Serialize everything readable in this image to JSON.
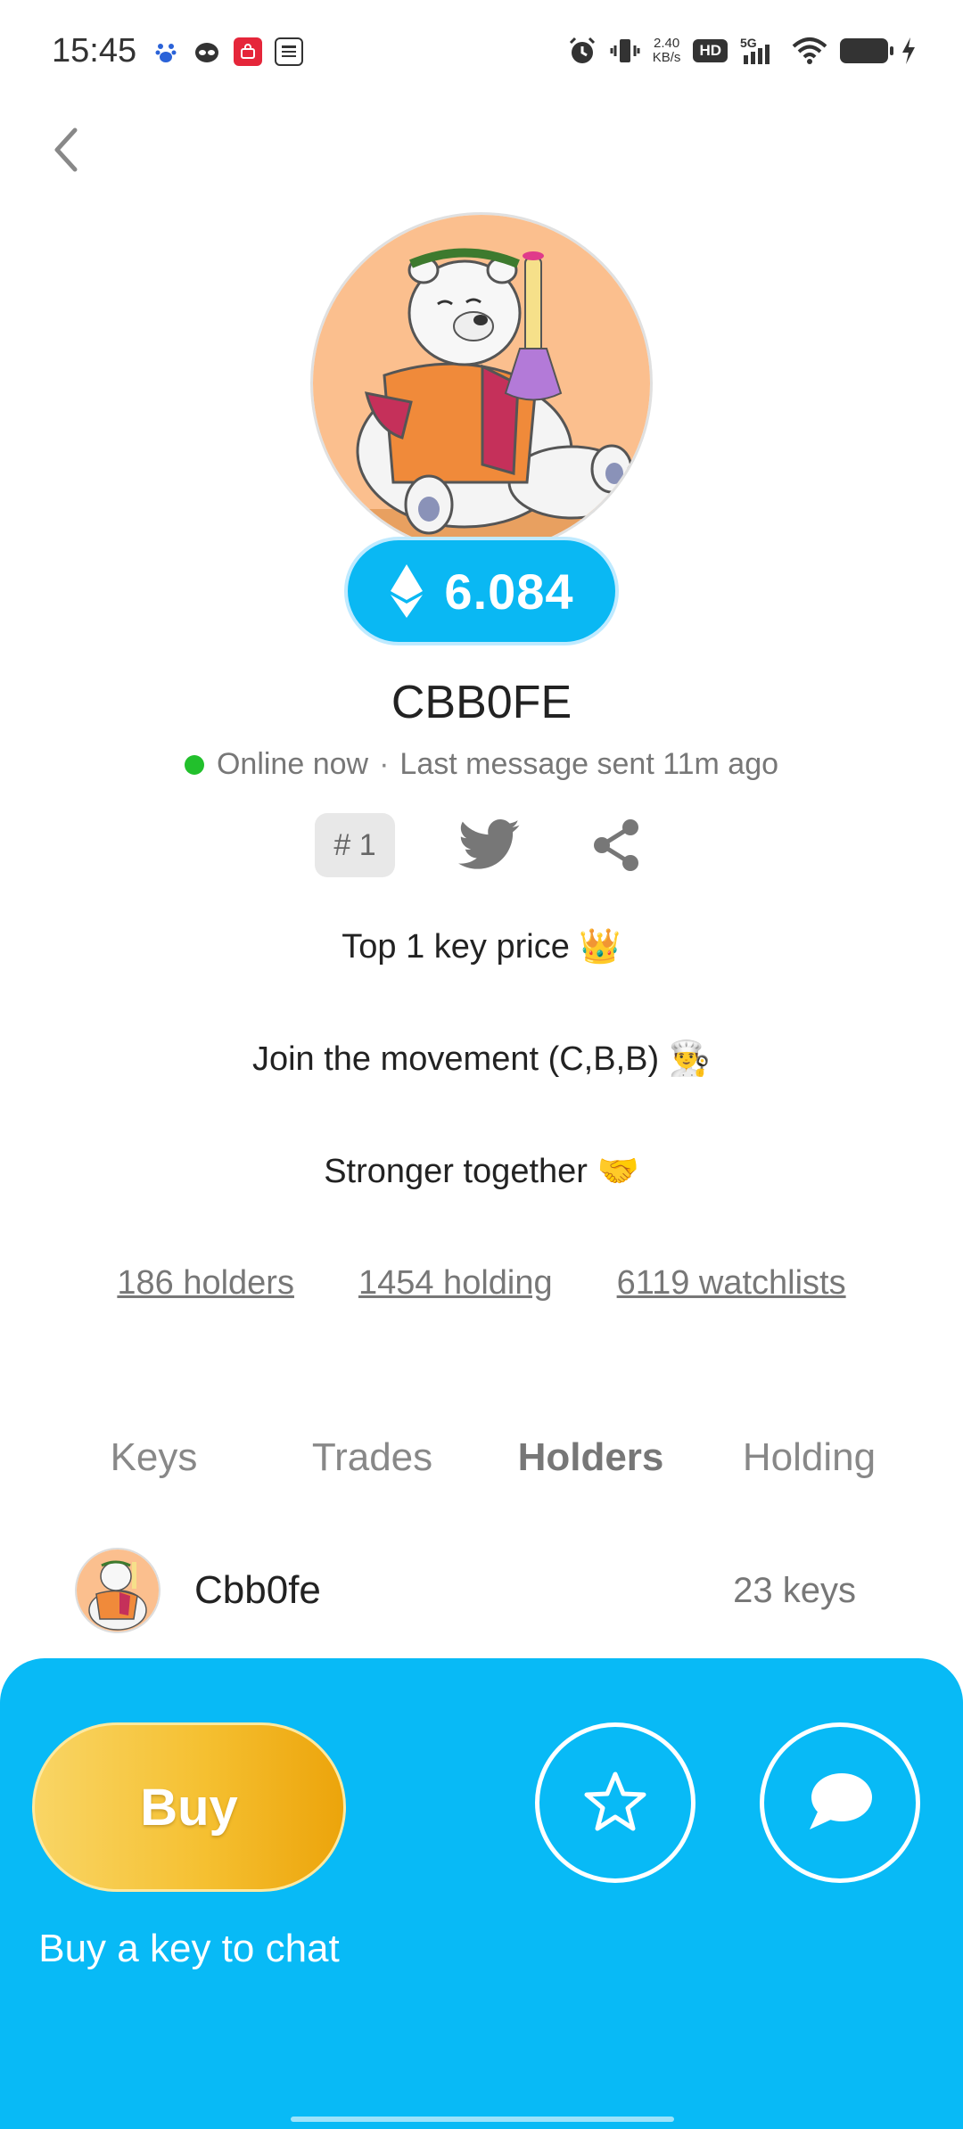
{
  "status_bar": {
    "time": "15:45",
    "net_speed_value": "2.40",
    "net_speed_unit": "KB/s",
    "hd": "HD",
    "network": "5G",
    "icons": [
      "baidu-icon",
      "cat-icon",
      "shopping-icon",
      "news-icon",
      "alarm-icon",
      "vibrate-icon",
      "wifi-icon",
      "battery-icon",
      "charging-icon"
    ]
  },
  "profile": {
    "price": "6.084",
    "currency_icon": "ethereum-icon",
    "username": "CBB0FE",
    "online_status": "Online now",
    "last_message": "Last message sent 11m ago",
    "rank": "# 1",
    "bio_lines": [
      "Top 1 key price 👑",
      "Join the movement (C,B,B) 👨‍🍳",
      "Stronger together 🤝"
    ],
    "stats": {
      "holders": "186 holders",
      "holding": "1454 holding",
      "watchlists": "6119 watchlists"
    }
  },
  "tabs": [
    {
      "label": "Keys",
      "active": false
    },
    {
      "label": "Trades",
      "active": false
    },
    {
      "label": "Holders",
      "active": true
    },
    {
      "label": "Holding",
      "active": false
    }
  ],
  "holders": [
    {
      "name": "Cbb0fe",
      "keys": "23 keys"
    }
  ],
  "bottom": {
    "buy_label": "Buy",
    "buy_hint": "Buy a key to chat"
  },
  "colors": {
    "accent": "#08baf6",
    "buy_gold": "#f5c031",
    "online": "#22c02c"
  }
}
